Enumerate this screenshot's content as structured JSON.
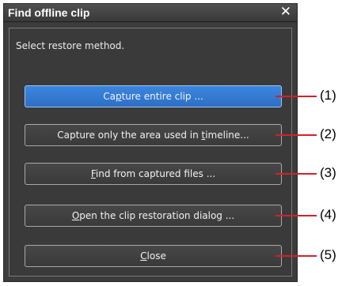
{
  "dialog": {
    "title": "Find offline clip",
    "close_glyph": "✕",
    "prompt": "Select restore method.",
    "buttons": [
      {
        "id": "capture-entire-clip",
        "before": "Ca",
        "mnemonic": "p",
        "after": "ture entire clip ...",
        "primary": true
      },
      {
        "id": "capture-area-timeline",
        "before": "Capture only the area used in ",
        "mnemonic": "t",
        "after": "imeline...",
        "primary": false
      },
      {
        "id": "find-captured-files",
        "before": "",
        "mnemonic": "F",
        "after": "ind from captured files ...",
        "primary": false
      },
      {
        "id": "open-restoration-dialog",
        "before": "",
        "mnemonic": "O",
        "after": "pen the clip restoration dialog ...",
        "primary": false
      },
      {
        "id": "close",
        "before": "",
        "mnemonic": "C",
        "after": "lose",
        "primary": false
      }
    ]
  },
  "callouts": [
    "(1)",
    "(2)",
    "(3)",
    "(4)",
    "(5)"
  ],
  "colors": {
    "dialog_bg": "#3c3c3c",
    "primary_button": "#3179d6",
    "callout_line": "#d4202a"
  }
}
